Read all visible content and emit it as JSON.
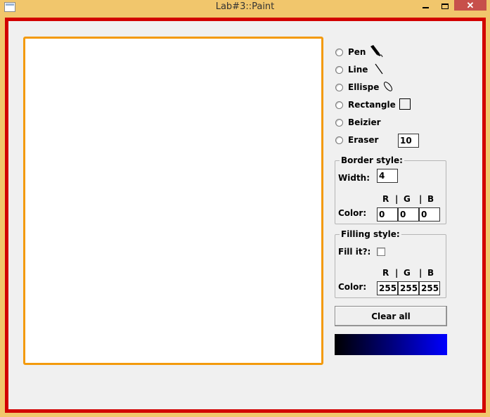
{
  "window": {
    "title": "Lab#3::Paint",
    "close_glyph": "✕"
  },
  "tools": [
    {
      "label": "Pen",
      "icon": "pen-icon"
    },
    {
      "label": "Line",
      "icon": "line-icon"
    },
    {
      "label": "Ellispe",
      "icon": "ellipse-icon"
    },
    {
      "label": "Rectangle",
      "icon": "rectangle-icon"
    },
    {
      "label": "Beizier",
      "icon": ""
    },
    {
      "label": "Eraser",
      "icon": ""
    }
  ],
  "eraser_size": "10",
  "border_style": {
    "title": "Border style:",
    "width_label": "Width:",
    "width_value": "4",
    "rgb_header": [
      "R",
      "|",
      "G",
      "|",
      "B"
    ],
    "color_label": "Color:",
    "r": "0",
    "g": "0",
    "b": "0"
  },
  "filling_style": {
    "title": "Filling style:",
    "fill_label": "Fill it?:",
    "fill_checked": false,
    "rgb_header": [
      "R",
      "|",
      "G",
      "|",
      "B"
    ],
    "color_label": "Color:",
    "r": "255",
    "g": "255",
    "b": "255"
  },
  "clear_button": "Clear all",
  "colors": {
    "frame": "#d20000",
    "canvas_border": "#f39a0c",
    "titlebar": "#f1c66c",
    "preview_start": "#000000",
    "preview_end": "#0000ff"
  }
}
